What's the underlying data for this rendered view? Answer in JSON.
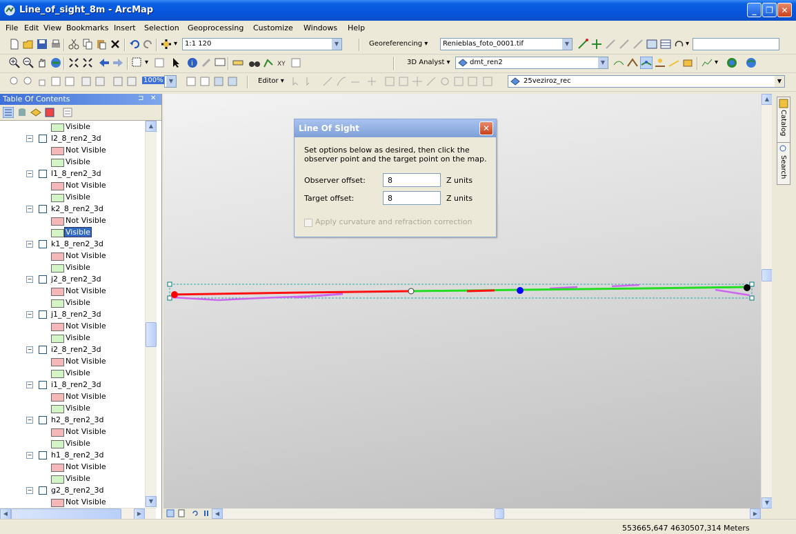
{
  "window": {
    "title": "Line_of_sight_8m - ArcMap"
  },
  "menu": [
    "File",
    "Edit",
    "View",
    "Bookmarks",
    "Insert",
    "Selection",
    "Geoprocessing",
    "Customize",
    "Windows",
    "Help"
  ],
  "toolbar1": {
    "scale": "1:1 120",
    "georef_label": "Georeferencing ▾",
    "georef_layer": "Renieblas_foto_0001.tif"
  },
  "toolbar2": {
    "analyst_label": "3D Analyst ▾",
    "analyst_layer": "dmt_ren2"
  },
  "toolbar3": {
    "zoom": "100%",
    "editor_label": "Editor ▾",
    "layer": "25veziroz_rec"
  },
  "toc": {
    "title": "Table Of Contents",
    "items": [
      {
        "type": "legend",
        "color": "green",
        "label": "Visible"
      },
      {
        "type": "layer",
        "label": "l2_8_ren2_3d"
      },
      {
        "type": "legend",
        "color": "red",
        "label": "Not Visible"
      },
      {
        "type": "legend",
        "color": "green",
        "label": "Visible"
      },
      {
        "type": "layer",
        "label": "l1_8_ren2_3d"
      },
      {
        "type": "legend",
        "color": "red",
        "label": "Not Visible"
      },
      {
        "type": "legend",
        "color": "green",
        "label": "Visible"
      },
      {
        "type": "layer",
        "label": "k2_8_ren2_3d"
      },
      {
        "type": "legend",
        "color": "red",
        "label": "Not Visible"
      },
      {
        "type": "legend",
        "color": "green",
        "label": "Visible",
        "selected": true
      },
      {
        "type": "layer",
        "label": "k1_8_ren2_3d"
      },
      {
        "type": "legend",
        "color": "red",
        "label": "Not Visible"
      },
      {
        "type": "legend",
        "color": "green",
        "label": "Visible"
      },
      {
        "type": "layer",
        "label": "j2_8_ren2_3d"
      },
      {
        "type": "legend",
        "color": "red",
        "label": "Not Visible"
      },
      {
        "type": "legend",
        "color": "green",
        "label": "Visible"
      },
      {
        "type": "layer",
        "label": "j1_8_ren2_3d"
      },
      {
        "type": "legend",
        "color": "red",
        "label": "Not Visible"
      },
      {
        "type": "legend",
        "color": "green",
        "label": "Visible"
      },
      {
        "type": "layer",
        "label": "i2_8_ren2_3d"
      },
      {
        "type": "legend",
        "color": "red",
        "label": "Not Visible"
      },
      {
        "type": "legend",
        "color": "green",
        "label": "Visible"
      },
      {
        "type": "layer",
        "label": "i1_8_ren2_3d"
      },
      {
        "type": "legend",
        "color": "red",
        "label": "Not Visible"
      },
      {
        "type": "legend",
        "color": "green",
        "label": "Visible"
      },
      {
        "type": "layer",
        "label": "h2_8_ren2_3d"
      },
      {
        "type": "legend",
        "color": "red",
        "label": "Not Visible"
      },
      {
        "type": "legend",
        "color": "green",
        "label": "Visible"
      },
      {
        "type": "layer",
        "label": "h1_8_ren2_3d"
      },
      {
        "type": "legend",
        "color": "red",
        "label": "Not Visible"
      },
      {
        "type": "legend",
        "color": "green",
        "label": "Visible"
      },
      {
        "type": "layer",
        "label": "g2_8_ren2_3d"
      },
      {
        "type": "legend",
        "color": "red",
        "label": "Not Visible"
      }
    ]
  },
  "dock": {
    "catalog": "Catalog",
    "search": "Search"
  },
  "dialog": {
    "title": "Line Of Sight",
    "description": "Set options below as desired, then click the observer point and the target point on the map.",
    "observer_label": "Observer offset:",
    "observer_value": "8",
    "target_label": "Target offset:",
    "target_value": "8",
    "unit": "Z units",
    "curvature_label": "Apply curvature and refraction correction"
  },
  "status": {
    "coords": "553665,647  4630507,314 Meters"
  },
  "colors": {
    "visible_line": "#22dd22",
    "not_visible_line": "#ff1010",
    "profile_line": "#cc66ee",
    "observer_point": "#ff0000",
    "blue_point": "#0000ff",
    "target_point": "#000000"
  }
}
